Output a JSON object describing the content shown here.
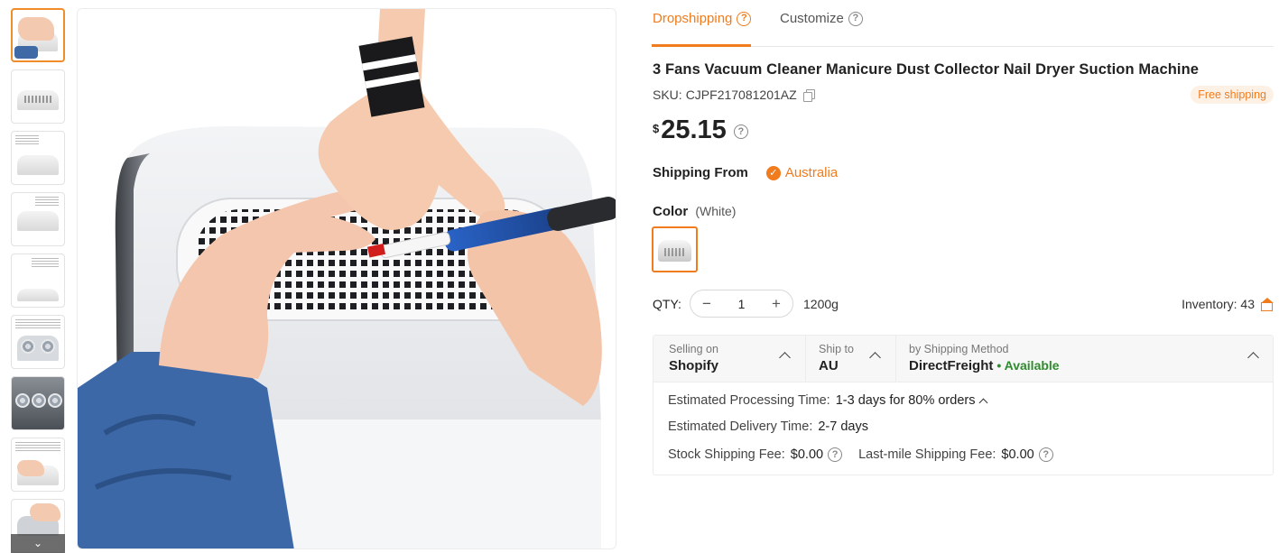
{
  "tabs": {
    "dropshipping": "Dropshipping",
    "customize": "Customize"
  },
  "product": {
    "title": "3 Fans Vacuum Cleaner Manicure Dust Collector Nail Dryer Suction Machine",
    "sku_label": "SKU:",
    "sku": "CJPF217081201AZ",
    "free_shipping": "Free shipping",
    "currency": "$",
    "price": "25.15"
  },
  "shipping_from": {
    "label": "Shipping From",
    "value": "Australia"
  },
  "color": {
    "label": "Color",
    "selected": "(White)"
  },
  "quantity": {
    "label": "QTY:",
    "value": "1",
    "minus": "−",
    "plus": "+",
    "weight": "1200g"
  },
  "inventory": {
    "label": "Inventory: 43"
  },
  "shipping": {
    "selling_on_label": "Selling on",
    "selling_on": "Shopify",
    "ship_to_label": "Ship to",
    "ship_to": "AU",
    "method_label": "by Shipping Method",
    "method": "DirectFreight",
    "availability": "• Available",
    "processing_label": "Estimated Processing Time:",
    "processing": "1-3 days for 80% orders",
    "delivery_label": "Estimated Delivery Time:",
    "delivery": "2-7 days",
    "stock_fee_label": "Stock Shipping Fee:",
    "stock_fee": "$0.00",
    "lastmile_fee_label": "Last-mile Shipping Fee:",
    "lastmile_fee": "$0.00"
  },
  "colors": {
    "accent": "#f07c1e",
    "available": "#2e8b2e"
  }
}
